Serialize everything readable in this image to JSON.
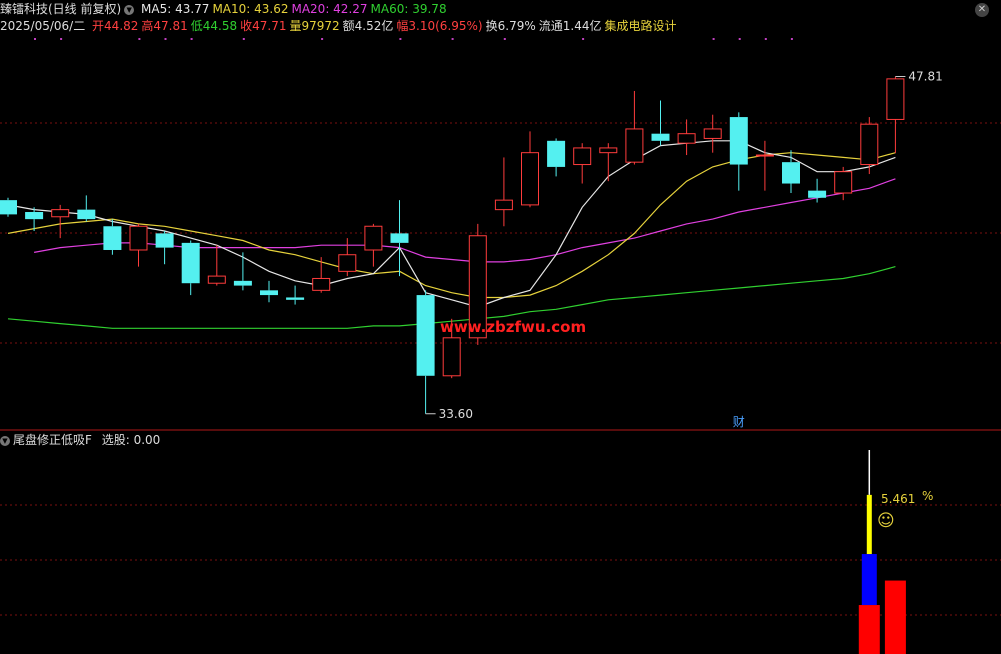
{
  "header": {
    "stock_name": "臻镭科技(日线 前复权)",
    "ma": [
      {
        "label": "MA5: 43.77",
        "color": "#e6e6e6"
      },
      {
        "label": "MA10: 43.62",
        "color": "#e6d23c"
      },
      {
        "label": "MA20: 42.27",
        "color": "#e040e0"
      },
      {
        "label": "MA60: 39.78",
        "color": "#30d030"
      }
    ],
    "date": "2025/05/06/二",
    "quote": [
      {
        "label": "开44.82",
        "color": "#ff4040"
      },
      {
        "label": "高47.81",
        "color": "#ff4040"
      },
      {
        "label": "低44.58",
        "color": "#30d030"
      },
      {
        "label": "收47.71",
        "color": "#ff4040"
      },
      {
        "label": "量97972",
        "color": "#e6d23c"
      },
      {
        "label": "额4.52亿",
        "color": "#dddddd"
      },
      {
        "label": "幅3.10(6.95%)",
        "color": "#ff4040"
      },
      {
        "label": "换6.79%",
        "color": "#dddddd"
      },
      {
        "label": "流通1.44亿",
        "color": "#dddddd"
      },
      {
        "label": "集成电路设计",
        "color": "#e6d23c"
      }
    ]
  },
  "watermark": "www.zbzfwu.com",
  "marker_cai": "财",
  "indicator": {
    "title": "尾盘修正低吸F",
    "select_label": "选股: 0.00",
    "value_text": "5.461",
    "percent_symbol": "%",
    "smiley": "☺"
  },
  "colors": {
    "up": "#ff3c3c",
    "down": "#54f0f0",
    "ma5": "#e6e6e6",
    "ma10": "#e6d23c",
    "ma20": "#e040e0",
    "ma60": "#30d030",
    "grid": "#7a1010",
    "bar_red": "#ff0000",
    "bar_blue": "#0000ff",
    "bar_yellow": "#ffff00"
  },
  "chart_data": [
    {
      "type": "candlestick",
      "ylim": [
        33.0,
        49.6
      ],
      "annotations": [
        {
          "label": "47.81",
          "value": 47.81,
          "kind": "high"
        },
        {
          "label": "33.60",
          "value": 33.6,
          "kind": "low"
        }
      ],
      "candles": [
        {
          "o": 42.6,
          "h": 42.7,
          "l": 41.9,
          "c": 42.0
        },
        {
          "o": 42.1,
          "h": 42.3,
          "l": 41.3,
          "c": 41.8
        },
        {
          "o": 41.9,
          "h": 42.4,
          "l": 41.0,
          "c": 42.2
        },
        {
          "o": 42.2,
          "h": 42.8,
          "l": 41.7,
          "c": 41.8
        },
        {
          "o": 41.5,
          "h": 41.8,
          "l": 40.3,
          "c": 40.5
        },
        {
          "o": 40.5,
          "h": 41.6,
          "l": 39.8,
          "c": 41.5
        },
        {
          "o": 41.2,
          "h": 41.3,
          "l": 39.9,
          "c": 40.6
        },
        {
          "o": 40.8,
          "h": 40.9,
          "l": 38.6,
          "c": 39.1
        },
        {
          "o": 39.1,
          "h": 40.7,
          "l": 39.0,
          "c": 39.4
        },
        {
          "o": 39.2,
          "h": 40.4,
          "l": 38.8,
          "c": 39.0
        },
        {
          "o": 38.8,
          "h": 39.2,
          "l": 38.3,
          "c": 38.6
        },
        {
          "o": 38.5,
          "h": 39.0,
          "l": 38.2,
          "c": 38.4
        },
        {
          "o": 38.8,
          "h": 40.2,
          "l": 38.7,
          "c": 39.3
        },
        {
          "o": 39.6,
          "h": 41.0,
          "l": 39.4,
          "c": 40.3
        },
        {
          "o": 40.5,
          "h": 41.6,
          "l": 39.8,
          "c": 41.5
        },
        {
          "o": 41.2,
          "h": 42.6,
          "l": 39.4,
          "c": 40.8
        },
        {
          "o": 38.6,
          "h": 38.8,
          "l": 33.6,
          "c": 35.2
        },
        {
          "o": 35.2,
          "h": 37.6,
          "l": 35.1,
          "c": 36.8
        },
        {
          "o": 36.8,
          "h": 41.6,
          "l": 36.5,
          "c": 41.1
        },
        {
          "o": 42.2,
          "h": 44.4,
          "l": 41.5,
          "c": 42.6
        },
        {
          "o": 42.4,
          "h": 45.5,
          "l": 42.3,
          "c": 44.6
        },
        {
          "o": 45.1,
          "h": 45.2,
          "l": 43.6,
          "c": 44.0
        },
        {
          "o": 44.1,
          "h": 45.0,
          "l": 43.3,
          "c": 44.8
        },
        {
          "o": 44.6,
          "h": 45.0,
          "l": 43.4,
          "c": 44.8
        },
        {
          "o": 44.2,
          "h": 47.2,
          "l": 44.1,
          "c": 45.6
        },
        {
          "o": 45.4,
          "h": 46.8,
          "l": 44.9,
          "c": 45.1
        },
        {
          "o": 45.0,
          "h": 46.0,
          "l": 44.5,
          "c": 45.4
        },
        {
          "o": 45.2,
          "h": 46.2,
          "l": 44.6,
          "c": 45.6
        },
        {
          "o": 46.1,
          "h": 46.3,
          "l": 43.0,
          "c": 44.1
        },
        {
          "o": 44.5,
          "h": 45.1,
          "l": 43.0,
          "c": 44.5
        },
        {
          "o": 44.2,
          "h": 44.7,
          "l": 42.9,
          "c": 43.3
        },
        {
          "o": 43.0,
          "h": 43.5,
          "l": 42.5,
          "c": 42.7
        },
        {
          "o": 42.9,
          "h": 44.0,
          "l": 42.6,
          "c": 43.8
        },
        {
          "o": 44.1,
          "h": 46.1,
          "l": 43.7,
          "c": 45.8
        },
        {
          "o": 46.0,
          "h": 47.81,
          "l": 44.58,
          "c": 47.71
        }
      ],
      "ma5": [
        42.4,
        42.2,
        42.1,
        42.0,
        41.7,
        41.5,
        41.3,
        41.0,
        40.7,
        40.2,
        39.6,
        39.2,
        39.0,
        39.3,
        39.5,
        40.6,
        38.7,
        38.4,
        38.1,
        38.5,
        38.8,
        40.3,
        42.3,
        43.6,
        44.3,
        44.9,
        45.0,
        45.1,
        45.1,
        44.6,
        44.4,
        43.8,
        43.8,
        44.0,
        44.4
      ],
      "ma10": [
        41.2,
        41.4,
        41.6,
        41.7,
        41.8,
        41.6,
        41.5,
        41.3,
        41.1,
        40.9,
        40.5,
        40.3,
        40.0,
        39.7,
        39.5,
        39.6,
        39.0,
        38.7,
        38.5,
        38.5,
        38.6,
        39.0,
        39.6,
        40.3,
        41.2,
        42.4,
        43.4,
        44.0,
        44.3,
        44.5,
        44.6,
        44.5,
        44.4,
        44.3,
        44.6
      ],
      "ma20": [
        null,
        40.4,
        40.6,
        40.7,
        40.8,
        40.8,
        40.7,
        40.6,
        40.6,
        40.6,
        40.6,
        40.6,
        40.7,
        40.7,
        40.7,
        40.6,
        40.2,
        40.1,
        40.0,
        40.0,
        40.1,
        40.3,
        40.6,
        40.8,
        41.0,
        41.3,
        41.6,
        41.8,
        42.1,
        42.3,
        42.5,
        42.7,
        42.9,
        43.1,
        43.5
      ],
      "ma60": [
        37.6,
        37.5,
        37.4,
        37.3,
        37.2,
        37.2,
        37.2,
        37.2,
        37.2,
        37.2,
        37.2,
        37.2,
        37.2,
        37.2,
        37.3,
        37.3,
        37.4,
        37.5,
        37.6,
        37.7,
        37.9,
        38.0,
        38.2,
        38.4,
        38.5,
        38.6,
        38.7,
        38.8,
        38.9,
        39.0,
        39.1,
        39.2,
        39.3,
        39.5,
        39.8
      ]
    },
    {
      "type": "bar",
      "ylim": [
        0,
        10
      ],
      "bars": [
        {
          "index": 33,
          "segments": [
            {
              "color": "bar_red",
              "value": 2.4
            },
            {
              "color": "bar_blue",
              "value": 2.5
            },
            {
              "color": "bar_yellow",
              "value": 2.9
            }
          ],
          "wick": 10.0
        },
        {
          "index": 34,
          "segments": [
            {
              "color": "bar_red",
              "value": 3.6
            }
          ]
        }
      ]
    }
  ]
}
